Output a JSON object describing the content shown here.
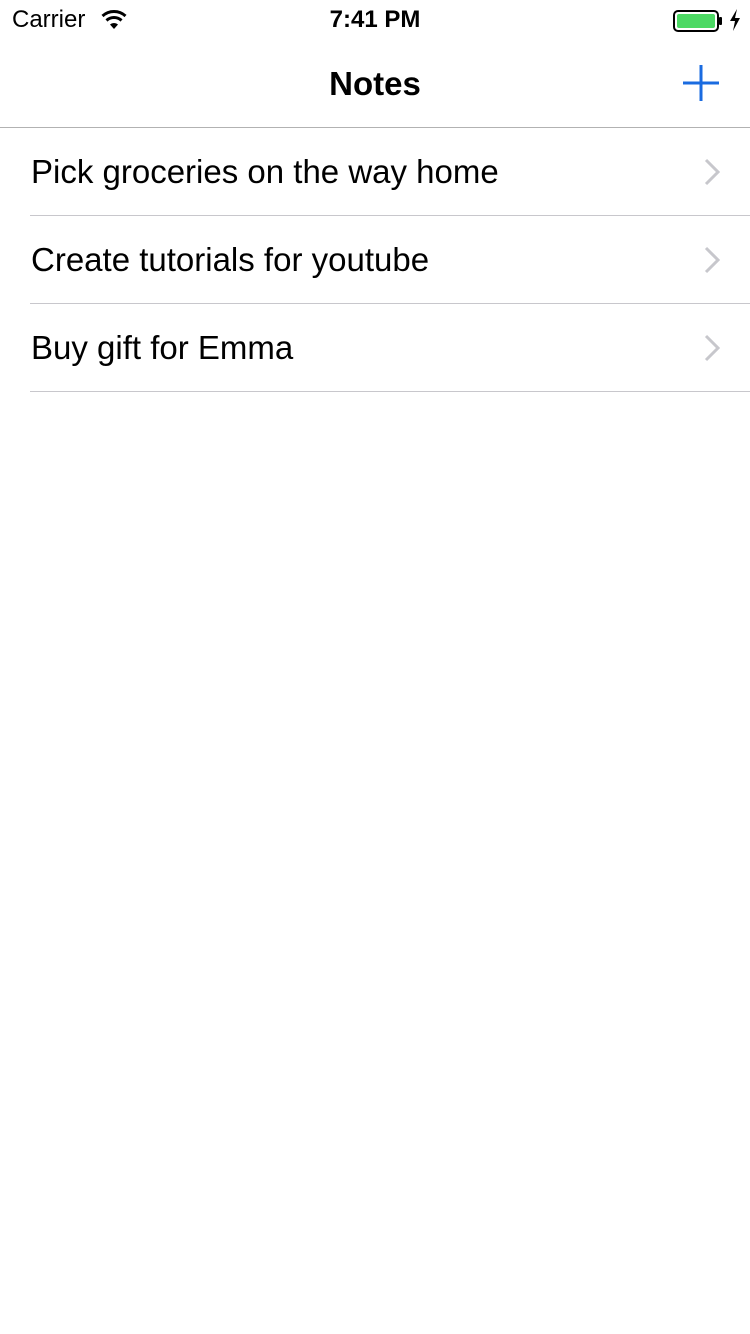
{
  "status_bar": {
    "carrier": "Carrier",
    "time": "7:41 PM",
    "battery_color": "#4cd964"
  },
  "nav": {
    "title": "Notes",
    "add_icon": "plus-icon",
    "accent_color": "#1a6be0"
  },
  "notes": [
    {
      "title": "Pick groceries on the way home"
    },
    {
      "title": "Create tutorials for youtube"
    },
    {
      "title": "Buy gift for Emma"
    }
  ]
}
